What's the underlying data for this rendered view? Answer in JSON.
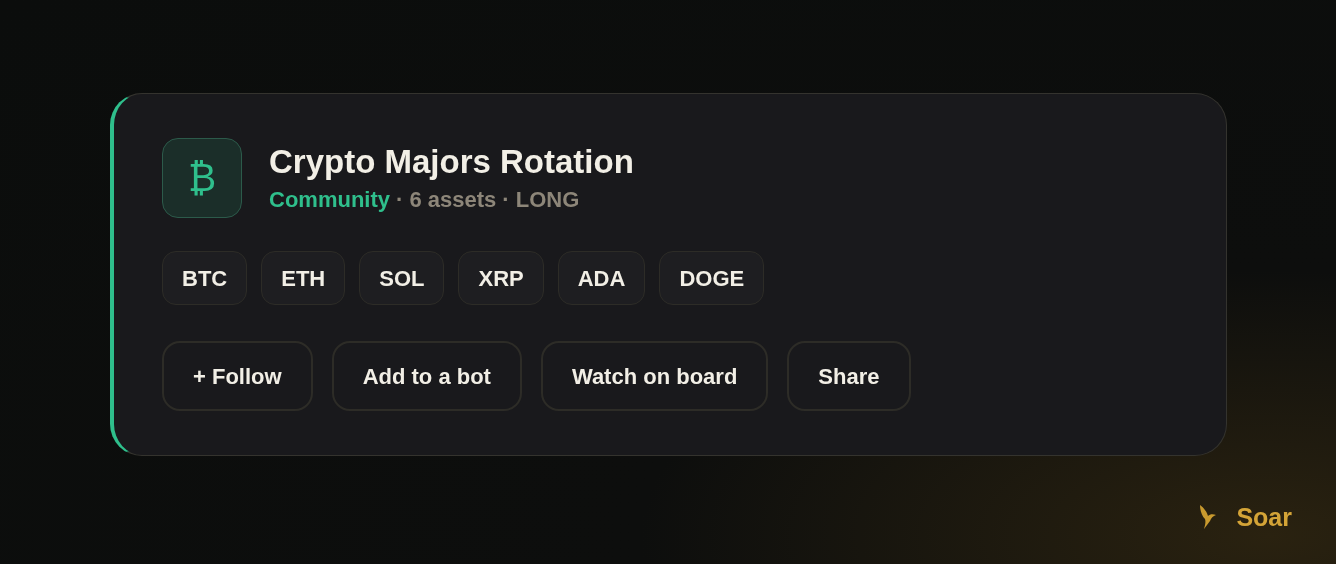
{
  "card": {
    "icon": "₿",
    "title": "Crypto Majors Rotation",
    "source": "Community",
    "meta": [
      "· 6 assets",
      "· LONG"
    ],
    "assets": [
      "BTC",
      "ETH",
      "SOL",
      "XRP",
      "ADA",
      "DOGE"
    ],
    "actions": [
      "+ Follow",
      "Add to a bot",
      "Watch on board",
      "Share"
    ]
  },
  "brand": {
    "name": "Soar"
  }
}
